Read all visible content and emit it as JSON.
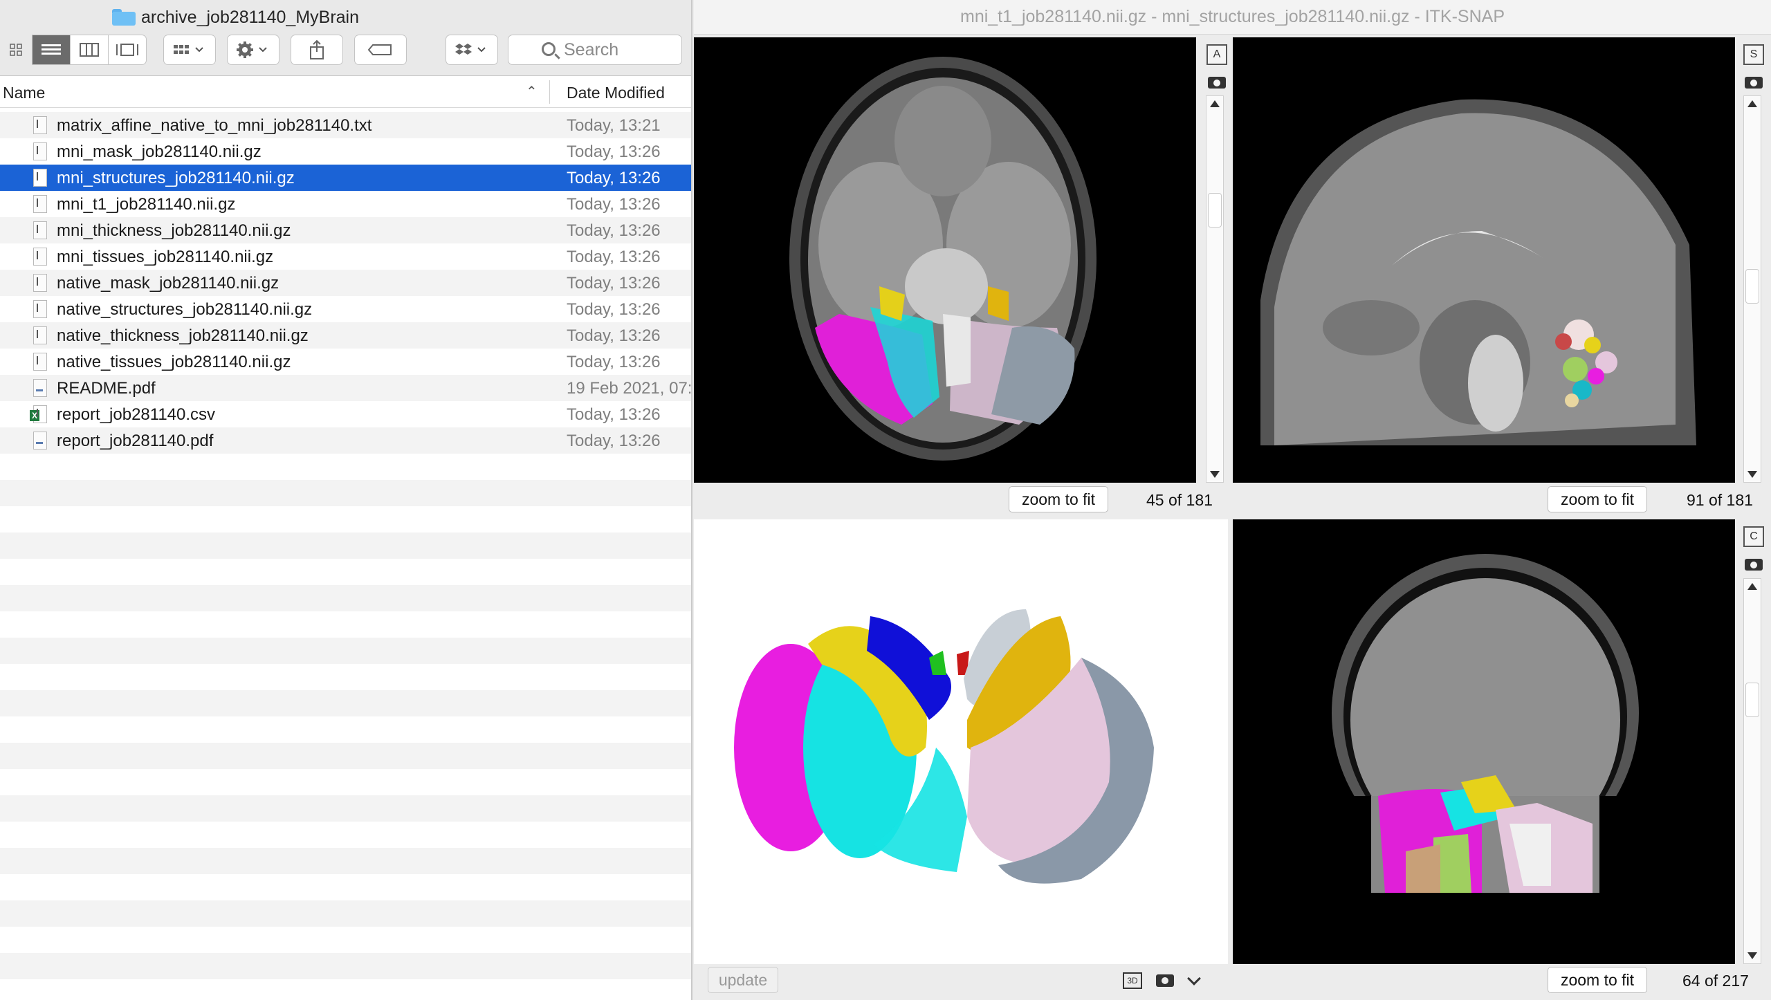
{
  "finder": {
    "folder_name": "archive_job281140_MyBrain",
    "search_placeholder": "Search",
    "columns": {
      "name": "Name",
      "date": "Date Modified"
    },
    "files": [
      {
        "name": "matrix_affine_native_to_mni_job281140.txt",
        "date": "Today, 13:21",
        "icon": "text-file-icon"
      },
      {
        "name": "mni_mask_job281140.nii.gz",
        "date": "Today, 13:26",
        "icon": "archive-file-icon"
      },
      {
        "name": "mni_structures_job281140.nii.gz",
        "date": "Today, 13:26",
        "icon": "archive-file-icon",
        "selected": true
      },
      {
        "name": "mni_t1_job281140.nii.gz",
        "date": "Today, 13:26",
        "icon": "archive-file-icon"
      },
      {
        "name": "mni_thickness_job281140.nii.gz",
        "date": "Today, 13:26",
        "icon": "archive-file-icon"
      },
      {
        "name": "mni_tissues_job281140.nii.gz",
        "date": "Today, 13:26",
        "icon": "archive-file-icon"
      },
      {
        "name": "native_mask_job281140.nii.gz",
        "date": "Today, 13:26",
        "icon": "archive-file-icon"
      },
      {
        "name": "native_structures_job281140.nii.gz",
        "date": "Today, 13:26",
        "icon": "archive-file-icon"
      },
      {
        "name": "native_thickness_job281140.nii.gz",
        "date": "Today, 13:26",
        "icon": "archive-file-icon"
      },
      {
        "name": "native_tissues_job281140.nii.gz",
        "date": "Today, 13:26",
        "icon": "archive-file-icon"
      },
      {
        "name": "README.pdf",
        "date": "19 Feb 2021, 07:",
        "icon": "pdf-file-icon"
      },
      {
        "name": "report_job281140.csv",
        "date": "Today, 13:26",
        "icon": "excel-file-icon"
      },
      {
        "name": "report_job281140.pdf",
        "date": "Today, 13:26",
        "icon": "pdf-file-icon"
      }
    ]
  },
  "itk": {
    "window_title": "mni_t1_job281140.nii.gz - mni_structures_job281140.nii.gz - ITK-SNAP",
    "axial": {
      "side_letter": "A",
      "zoom_label": "zoom to fit",
      "slice": "45 of 181"
    },
    "sagittal": {
      "side_letter": "S",
      "zoom_label": "zoom to fit",
      "slice": "91 of 181"
    },
    "coronal": {
      "side_letter": "C",
      "zoom_label": "zoom to fit",
      "slice": "64 of 217"
    },
    "render3d": {
      "update_label": "update",
      "mode_label": "3D"
    }
  },
  "colors": {
    "selection": "#1b63d6",
    "magenta": "#e81ee0",
    "cyan": "#16e3e3",
    "yellow": "#e6d21a",
    "blue": "#1010d8",
    "gray_blue": "#8a98a8",
    "pink_lavender": "#e4c6dc",
    "gold": "#e0b40e",
    "silver": "#c8cfd6"
  }
}
